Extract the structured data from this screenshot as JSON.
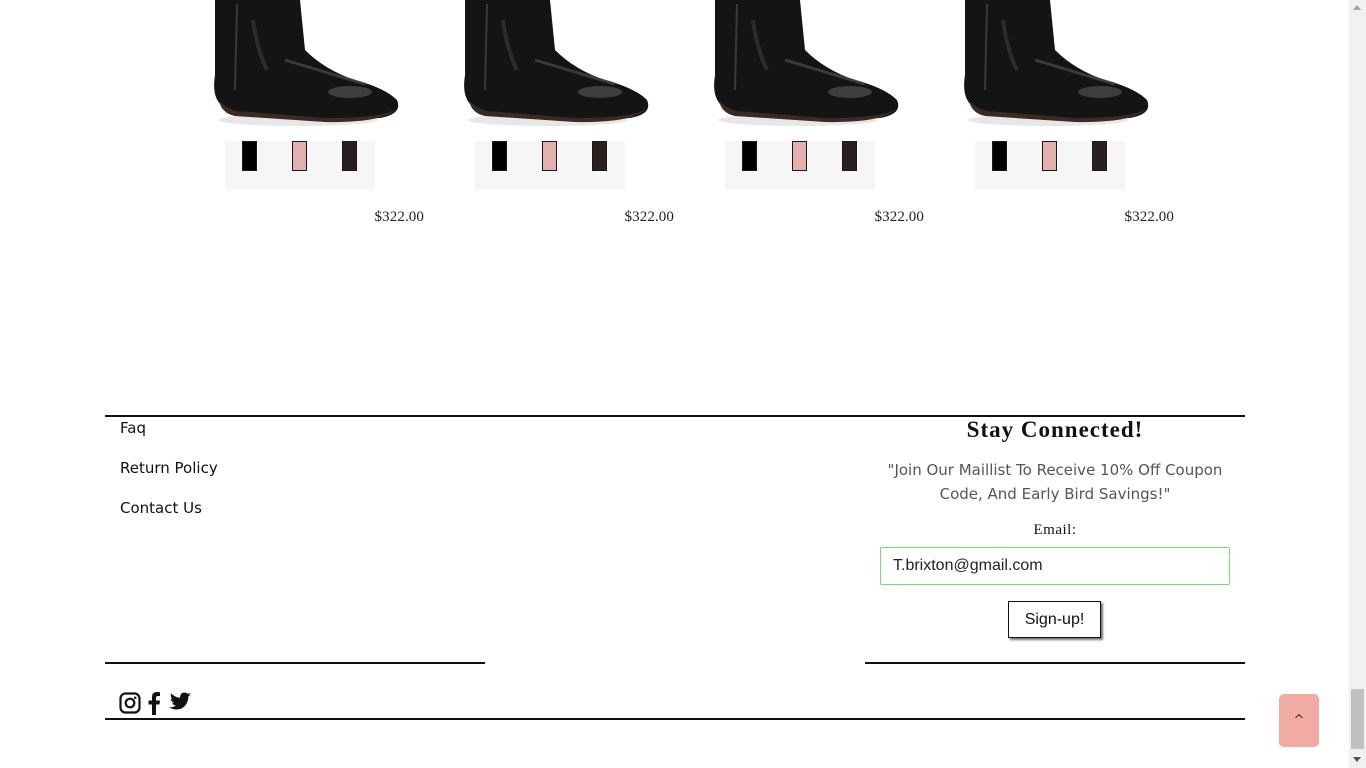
{
  "products": [
    {
      "price": "$322.00",
      "swatches": [
        "#000000",
        "#e2b1ad",
        "#2a1f1f"
      ]
    },
    {
      "price": "$322.00",
      "swatches": [
        "#000000",
        "#e2b1ad",
        "#2a1f1f"
      ]
    },
    {
      "price": "$322.00",
      "swatches": [
        "#000000",
        "#e2b1ad",
        "#2a1f1f"
      ]
    },
    {
      "price": "$322.00",
      "swatches": [
        "#000000",
        "#e2b1ad",
        "#2a1f1f"
      ]
    }
  ],
  "footer": {
    "links": [
      "Faq",
      "Return Policy",
      "Contact Us"
    ],
    "newsletter": {
      "title": "Stay Connected!",
      "text": "\"Join Our Maillist To Receive 10% Off Coupon Code, And Early Bird Savings!\"",
      "email_label": "Email:",
      "email_value": "T.brixton@gmail.com",
      "button_label": "Sign-up!"
    },
    "social_icons": [
      "instagram-icon",
      "facebook-icon",
      "twitter-icon"
    ]
  },
  "scroll_top": {
    "label": "^",
    "color": "#f2aaa5"
  },
  "colors": {
    "input_border": "#6ee26e",
    "rule": "#111111"
  }
}
